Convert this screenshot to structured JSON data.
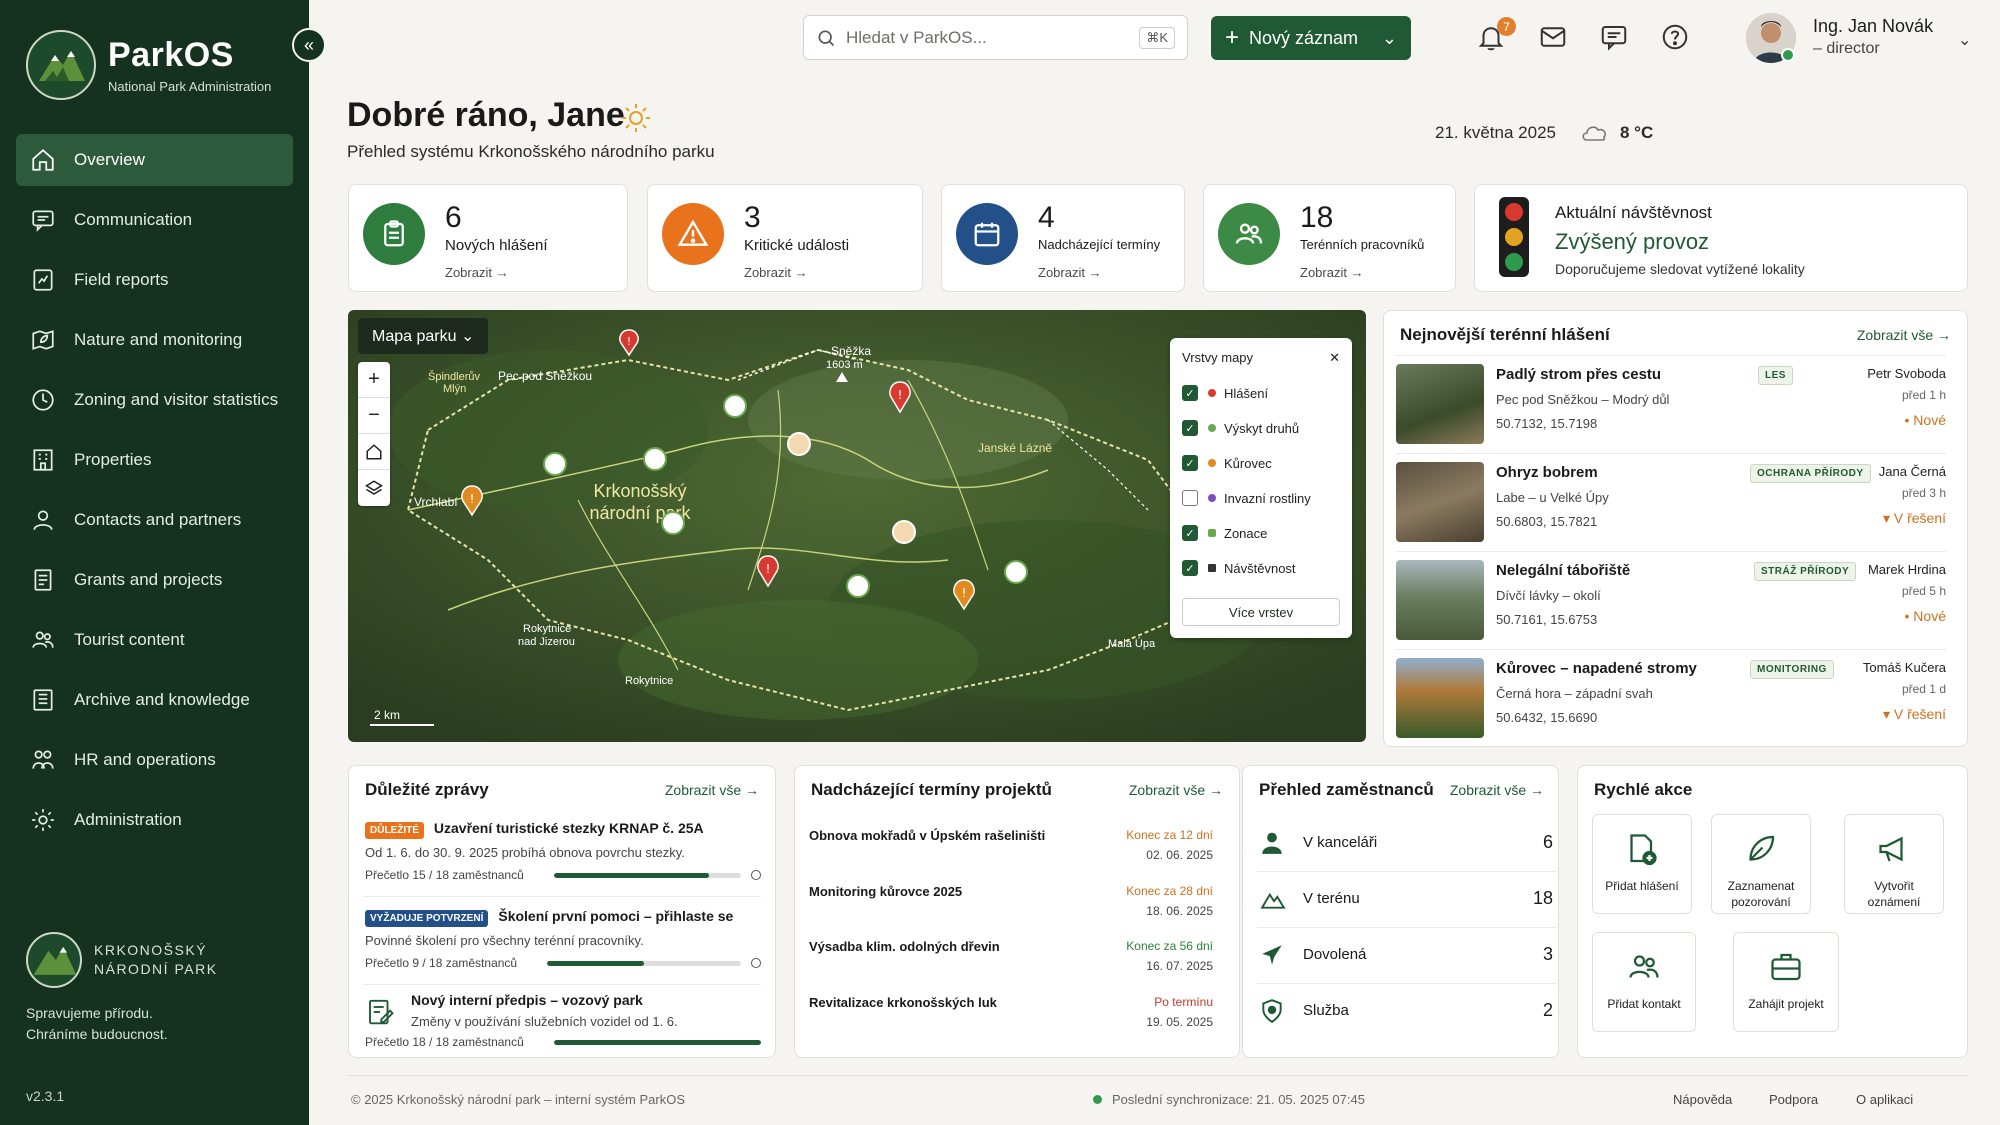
{
  "app": {
    "name": "ParkOS",
    "subtitle": "National Park Administration",
    "version": "v2.3.1"
  },
  "sidebar": {
    "items": [
      {
        "label": "Overview",
        "icon": "home-icon"
      },
      {
        "label": "Communication",
        "icon": "message-icon"
      },
      {
        "label": "Field reports",
        "icon": "report-icon"
      },
      {
        "label": "Nature and monitoring",
        "icon": "leaf-map-icon"
      },
      {
        "label": "Zoning and visitor statistics",
        "icon": "clock-chart-icon"
      },
      {
        "label": "Properties",
        "icon": "building-icon"
      },
      {
        "label": "Contacts and partners",
        "icon": "person-icon"
      },
      {
        "label": "Grants and projects",
        "icon": "document-icon"
      },
      {
        "label": "Tourist content",
        "icon": "people-icon"
      },
      {
        "label": "Archive and knowledge",
        "icon": "archive-icon"
      },
      {
        "label": "HR and operations",
        "icon": "team-icon"
      },
      {
        "label": "Administration",
        "icon": "gear-icon"
      }
    ],
    "brand_line1": "KRKONOŠSKÝ",
    "brand_line2": "NÁRODNÍ PARK",
    "slogan_line1": "Spravujeme přírodu.",
    "slogan_line2": "Chráníme budoucnost."
  },
  "topbar": {
    "search_placeholder": "Hledat v ParkOS...",
    "search_shortcut": "⌘K",
    "new_button": "Nový záznam",
    "notification_count": "7",
    "user_name": "Ing. Jan Novák",
    "user_role": "– director"
  },
  "header": {
    "greeting": "Dobré ráno, Jane",
    "subtitle": "Přehled systému Krkonošského národního parku",
    "date": "21. května 2025",
    "temperature": "8 °C"
  },
  "stats": [
    {
      "value": "6",
      "label": "Nových hlášení",
      "link": "Zobrazit →",
      "color": "#2f7d3e"
    },
    {
      "value": "3",
      "label": "Kritické události",
      "link": "Zobrazit →",
      "color": "#e8731c"
    },
    {
      "value": "4",
      "label": "Nadcházející termíny",
      "link": "Zobrazit →",
      "color": "#24508a"
    },
    {
      "value": "18",
      "label": "Terénních pracovníků",
      "link": "Zobrazit →",
      "color": "#3c8a45"
    }
  ],
  "traffic": {
    "title": "Aktuální návštěvnost",
    "status": "Zvýšený provoz",
    "note": "Doporučujeme sledovat vytížené lokality"
  },
  "map": {
    "title": "Mapa parku",
    "park_name_1": "Krkonošský",
    "park_name_2": "národní park",
    "places": [
      "Špindlerův",
      "Mlýn",
      "Pec pod Sněžkou",
      "Sněžka",
      "1603 m",
      "Janské Lázně",
      "Vrchlabí",
      "Rokytnice",
      "nad Jizerou",
      "Rokytnice",
      "Malá Úpa"
    ],
    "scale": "2 km",
    "layers_title": "Vrstvy mapy",
    "layers": [
      {
        "label": "Hlášení",
        "checked": true,
        "color": "#d93a2f"
      },
      {
        "label": "Výskyt druhů",
        "checked": true,
        "color": "#6aa84f"
      },
      {
        "label": "Kůrovec",
        "checked": true,
        "color": "#e08a1f"
      },
      {
        "label": "Invazní rostliny",
        "checked": false,
        "color": "#7a4fc0"
      },
      {
        "label": "Zonace",
        "checked": true,
        "color": "#6aa84f"
      },
      {
        "label": "Návštěvnost",
        "checked": true,
        "color": "#333333"
      }
    ],
    "more_layers": "Více vrstev"
  },
  "reports": {
    "title": "Nejnovější terénní hlášení",
    "link": "Zobrazit vše →",
    "items": [
      {
        "title": "Padlý strom přes cestu",
        "tag": "LES",
        "location": "Pec pod Sněžkou – Modrý důl",
        "gps": "50.7132, 15.7198",
        "person": "Petr Svoboda",
        "time": "před 1 h",
        "status": "• Nové"
      },
      {
        "title": "Ohryz bobrem",
        "tag": "OCHRANA PŘÍRODY",
        "location": "Labe – u Velké Úpy",
        "gps": "50.6803, 15.7821",
        "person": "Jana Černá",
        "time": "před 3 h",
        "status": "▾ V řešení"
      },
      {
        "title": "Nelegální tábořiště",
        "tag": "STRÁŽ PŘÍRODY",
        "location": "Dívčí lávky – okolí",
        "gps": "50.7161, 15.6753",
        "person": "Marek Hrdina",
        "time": "před 5 h",
        "status": "• Nové"
      },
      {
        "title": "Kůrovec – napadené stromy",
        "tag": "MONITORING",
        "location": "Černá hora – západní svah",
        "gps": "50.6432, 15.6690",
        "person": "Tomáš Kučera",
        "time": "před 1 d",
        "status": "▾ V řešení"
      }
    ]
  },
  "news": {
    "title": "Důležité zprávy",
    "link": "Zobrazit vše →",
    "items": [
      {
        "pill": "DŮLEŽITÉ",
        "title": "Uzavření turistické stezky KRNAP č. 25A",
        "desc": "Od 1. 6. do 30. 9. 2025 probíhá obnova povrchu stezky.",
        "read": "Přečetlo 15 / 18 zaměstnanců",
        "progress": 0.83
      },
      {
        "pill": "VYŽADUJE POTVRZENÍ",
        "title": "Školení první pomoci – přihlaste se",
        "desc": "Povinné školení pro všechny terénní pracovníky.",
        "read": "Přečetlo 9 / 18 zaměstnanců",
        "progress": 0.5
      },
      {
        "pill": "",
        "title": "Nový interní předpis – vozový park",
        "desc": "Změny v používání služebních vozidel od 1. 6.",
        "read": "Přečetlo 18 / 18 zaměstnanců",
        "progress": 1.0
      }
    ]
  },
  "terms": {
    "title": "Nadcházející termíny projektů",
    "link": "Zobrazit vše →",
    "items": [
      {
        "name": "Obnova mokřadů v Úpském rašeliništi",
        "rel": "Konec za 12 dní",
        "date": "02. 06. 2025",
        "color": "#d07020"
      },
      {
        "name": "Monitoring kůrovce 2025",
        "rel": "Konec za 28 dní",
        "date": "18. 06. 2025",
        "color": "#d07020"
      },
      {
        "name": "Výsadba klim. odolných dřevin",
        "rel": "Konec za 56 dní",
        "date": "16. 07. 2025",
        "color": "#2f7d3e"
      },
      {
        "name": "Revitalizace krkonošských luk",
        "rel": "Po termínu",
        "date": "19. 05. 2025",
        "color": "#c0392b"
      }
    ]
  },
  "employees": {
    "title": "Přehled zaměstnanců",
    "link": "Zobrazit vše →",
    "items": [
      {
        "label": "V kanceláři",
        "count": "6",
        "icon": "person-icon"
      },
      {
        "label": "V terénu",
        "count": "18",
        "icon": "mountain-icon"
      },
      {
        "label": "Dovolená",
        "count": "3",
        "icon": "plane-icon"
      },
      {
        "label": "Služba",
        "count": "2",
        "icon": "shield-icon"
      }
    ]
  },
  "quick": {
    "title": "Rychlé akce",
    "items": [
      {
        "label1": "Přidat hlášení",
        "label2": ""
      },
      {
        "label1": "Zaznamenat",
        "label2": "pozorování"
      },
      {
        "label1": "Vytvořit",
        "label2": "oznámení"
      },
      {
        "label1": "Přidat kontakt",
        "label2": ""
      },
      {
        "label1": "Zahájit projekt",
        "label2": ""
      }
    ]
  },
  "footer": {
    "copyright": "© 2025 Krkonošský národní park – interní systém ParkOS",
    "sync": "Poslední synchronizace: 21. 05. 2025 07:45",
    "links": [
      "Nápověda",
      "Podpora",
      "O aplikaci"
    ]
  },
  "colors": {
    "primary": "#1f5a34",
    "sidebar": "#14321f",
    "warning": "#e8731c",
    "danger": "#d93a2f"
  }
}
